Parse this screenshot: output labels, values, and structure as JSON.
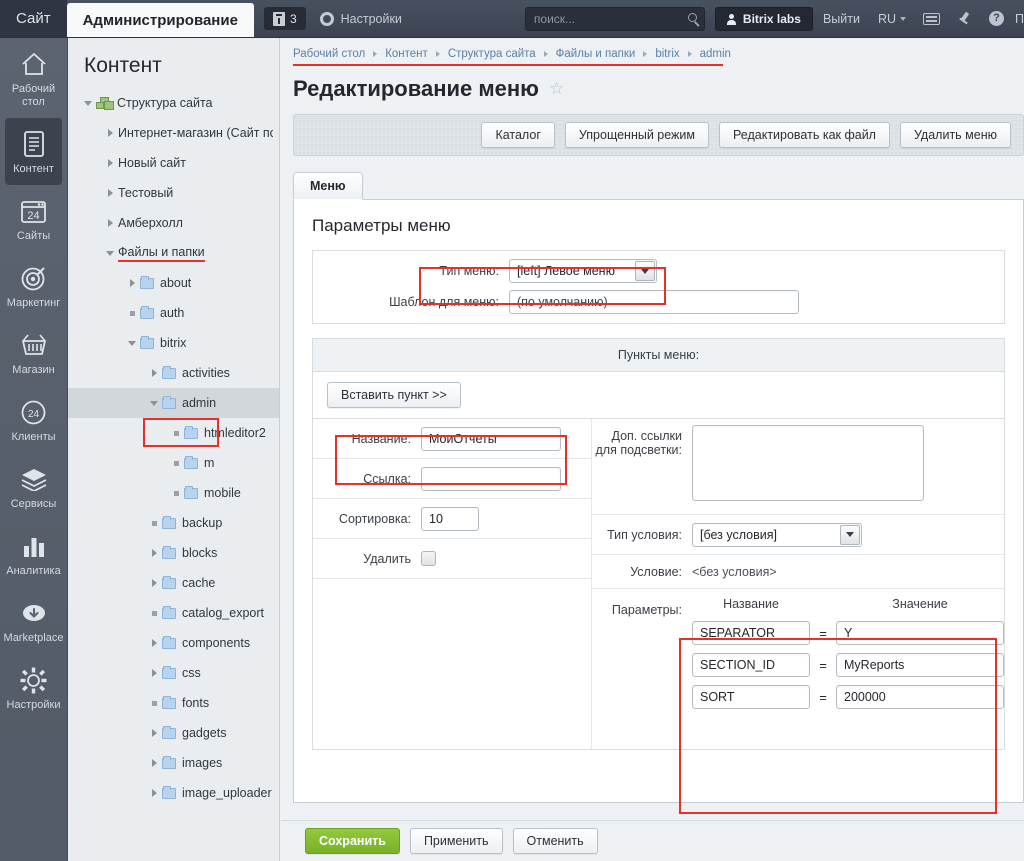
{
  "topbar": {
    "tab_site": "Сайт",
    "tab_admin": "Администрирование",
    "notif_count": "3",
    "settings_label": "Настройки",
    "search_placeholder": "поиск...",
    "search_value": "",
    "labs_label": "Bitrix labs",
    "logout_label": "Выйти",
    "lang": "RU",
    "help_trailing": "П"
  },
  "rail": {
    "items": [
      {
        "label": "Рабочий стол",
        "icon": "home-icon",
        "active": false
      },
      {
        "label": "Контент",
        "icon": "document-icon",
        "active": true
      },
      {
        "label": "Сайты",
        "icon": "calendar24-icon",
        "active": false
      },
      {
        "label": "Маркетинг",
        "icon": "target-icon",
        "active": false
      },
      {
        "label": "Магазин",
        "icon": "basket-icon",
        "active": false
      },
      {
        "label": "Клиенты",
        "icon": "clients24-icon",
        "active": false
      },
      {
        "label": "Сервисы",
        "icon": "layers-icon",
        "active": false
      },
      {
        "label": "Аналитика",
        "icon": "barchart-icon",
        "active": false
      },
      {
        "label": "Marketplace",
        "icon": "cloud-download-icon",
        "active": false
      },
      {
        "label": "Настройки",
        "icon": "gear-icon",
        "active": false
      }
    ]
  },
  "tree": {
    "title": "Контент",
    "nodes": [
      {
        "label": "Структура сайта",
        "indent": 0,
        "twisty": "down",
        "icon": "sitemap",
        "selected": false,
        "underlined": false
      },
      {
        "label": "Интернет-магазин (Сайт по у",
        "indent": 1,
        "twisty": "right",
        "icon": "none",
        "selected": false,
        "underlined": false
      },
      {
        "label": "Новый сайт",
        "indent": 1,
        "twisty": "right",
        "icon": "none",
        "selected": false,
        "underlined": false
      },
      {
        "label": "Тестовый",
        "indent": 1,
        "twisty": "right",
        "icon": "none",
        "selected": false,
        "underlined": false
      },
      {
        "label": "Амберхолл",
        "indent": 1,
        "twisty": "right",
        "icon": "none",
        "selected": false,
        "underlined": false
      },
      {
        "label": "Файлы и папки",
        "indent": 1,
        "twisty": "down",
        "icon": "none",
        "selected": false,
        "underlined": true
      },
      {
        "label": "about",
        "indent": 2,
        "twisty": "right",
        "icon": "folder",
        "selected": false,
        "underlined": false
      },
      {
        "label": "auth",
        "indent": 2,
        "twisty": "dot",
        "icon": "folder",
        "selected": false,
        "underlined": false
      },
      {
        "label": "bitrix",
        "indent": 2,
        "twisty": "down",
        "icon": "folder",
        "selected": false,
        "underlined": false
      },
      {
        "label": "activities",
        "indent": 3,
        "twisty": "right",
        "icon": "folder",
        "selected": false,
        "underlined": false
      },
      {
        "label": "admin",
        "indent": 3,
        "twisty": "down",
        "icon": "folder",
        "selected": true,
        "underlined": false
      },
      {
        "label": "htmleditor2",
        "indent": 4,
        "twisty": "dot",
        "icon": "folder",
        "selected": false,
        "underlined": false
      },
      {
        "label": "m",
        "indent": 4,
        "twisty": "dot",
        "icon": "folder",
        "selected": false,
        "underlined": false
      },
      {
        "label": "mobile",
        "indent": 4,
        "twisty": "dot",
        "icon": "folder",
        "selected": false,
        "underlined": false
      },
      {
        "label": "backup",
        "indent": 3,
        "twisty": "dot",
        "icon": "folder",
        "selected": false,
        "underlined": false
      },
      {
        "label": "blocks",
        "indent": 3,
        "twisty": "right",
        "icon": "folder",
        "selected": false,
        "underlined": false
      },
      {
        "label": "cache",
        "indent": 3,
        "twisty": "right",
        "icon": "folder",
        "selected": false,
        "underlined": false
      },
      {
        "label": "catalog_export",
        "indent": 3,
        "twisty": "dot",
        "icon": "folder",
        "selected": false,
        "underlined": false
      },
      {
        "label": "components",
        "indent": 3,
        "twisty": "right",
        "icon": "folder",
        "selected": false,
        "underlined": false
      },
      {
        "label": "css",
        "indent": 3,
        "twisty": "right",
        "icon": "folder",
        "selected": false,
        "underlined": false
      },
      {
        "label": "fonts",
        "indent": 3,
        "twisty": "dot",
        "icon": "folder",
        "selected": false,
        "underlined": false
      },
      {
        "label": "gadgets",
        "indent": 3,
        "twisty": "right",
        "icon": "folder",
        "selected": false,
        "underlined": false
      },
      {
        "label": "images",
        "indent": 3,
        "twisty": "right",
        "icon": "folder",
        "selected": false,
        "underlined": false
      },
      {
        "label": "image_uploader",
        "indent": 3,
        "twisty": "right",
        "icon": "folder",
        "selected": false,
        "underlined": false
      }
    ]
  },
  "main": {
    "breadcrumb": [
      "Рабочий стол",
      "Контент",
      "Структура сайта",
      "Файлы и папки",
      "bitrix",
      "admin"
    ],
    "page_title": "Редактирование меню",
    "toolbar_buttons": [
      "Каталог",
      "Упрощенный режим",
      "Редактировать как файл",
      "Удалить меню"
    ],
    "tab_label": "Меню",
    "section_title": "Параметры меню",
    "menu_type_label": "Тип меню:",
    "menu_type_value": "[left] Левое меню",
    "template_label": "Шаблон для меню:",
    "template_value": "(по умолчанию)",
    "items_header": "Пункты меню:",
    "insert_item_button": "Вставить пункт >>",
    "name_label": "Название:",
    "name_value": "МоиОтчеты",
    "link_label": "Ссылка:",
    "link_value": "",
    "sort_label": "Сортировка:",
    "sort_value": "10",
    "delete_label": "Удалить",
    "extra_links_label": "Доп. ссылки для подсветки:",
    "extra_links_value": "",
    "cond_type_label": "Тип условия:",
    "cond_type_value": "[без условия]",
    "cond_label": "Условие:",
    "cond_value": "<без условия>",
    "params_label": "Параметры:",
    "params_col_name": "Название",
    "params_col_value": "Значение",
    "params": [
      {
        "name": "SEPARATOR",
        "value": "Y"
      },
      {
        "name": "SECTION_ID",
        "value": "MyReports"
      },
      {
        "name": "SORT",
        "value": "200000"
      }
    ]
  },
  "footer": {
    "save": "Сохранить",
    "apply": "Применить",
    "cancel": "Отменить"
  },
  "colors": {
    "accent_red": "#e8302a",
    "save_green": "#79b227",
    "header_dark": "#3f4857",
    "link_blue": "#5a7fa8"
  }
}
